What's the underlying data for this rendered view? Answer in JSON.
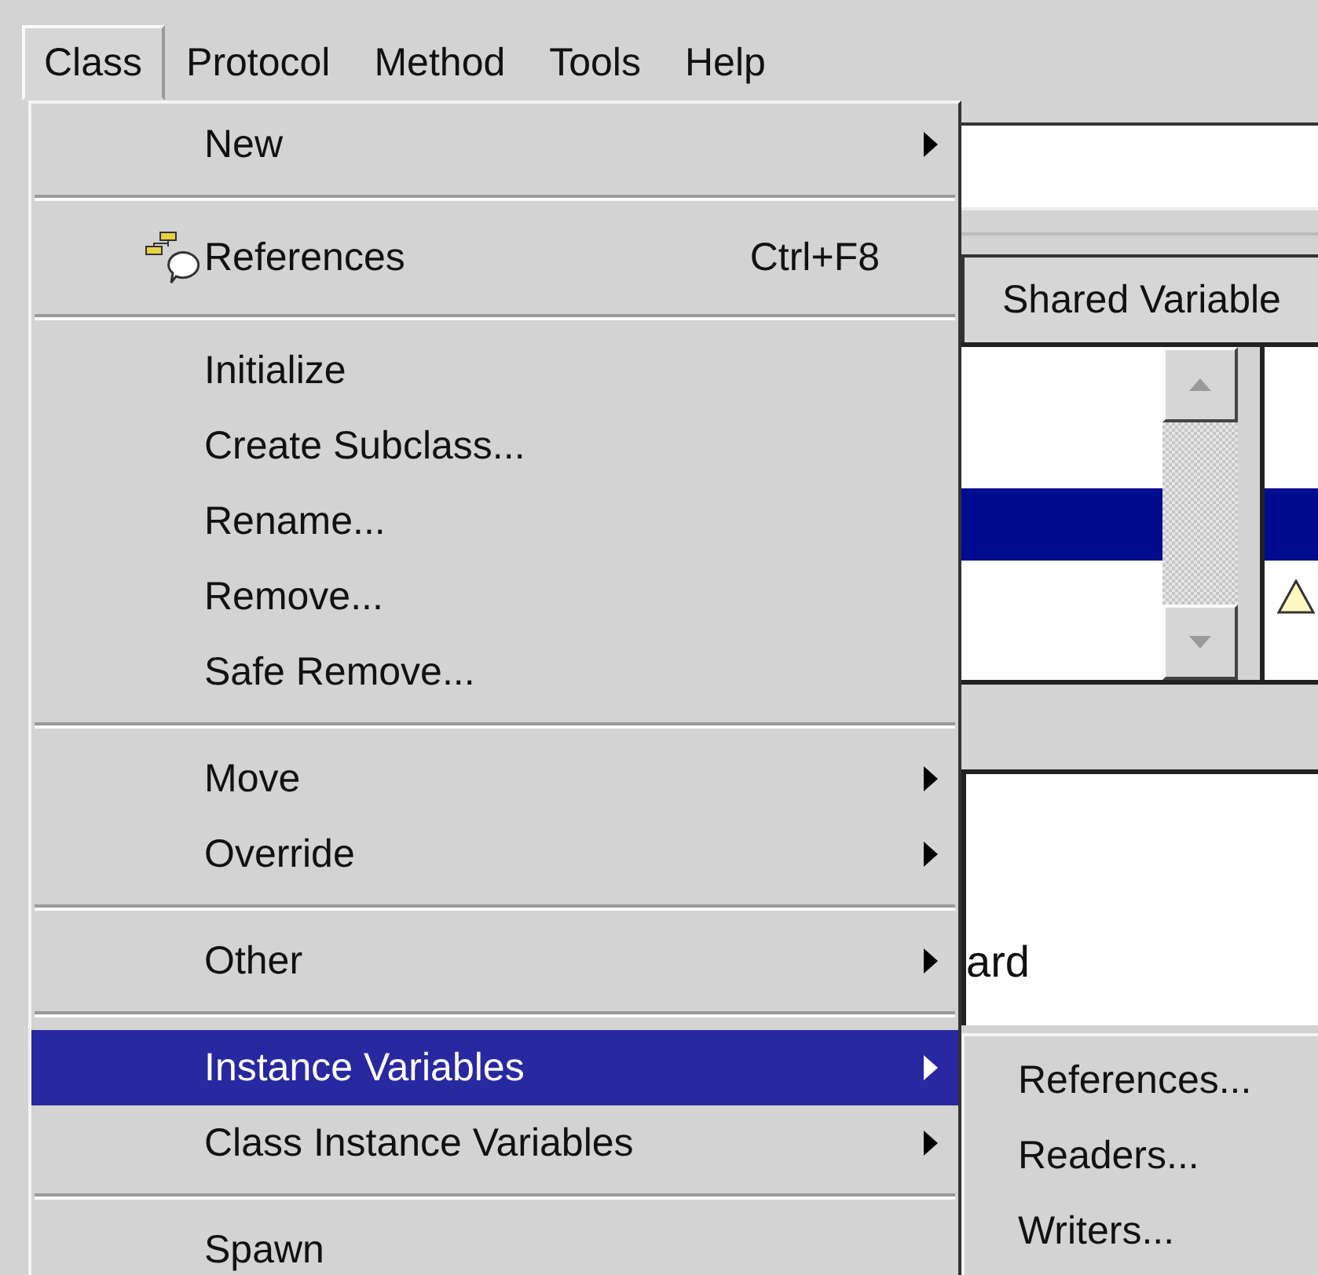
{
  "menubar": [
    {
      "label": "Class",
      "selected": true
    },
    {
      "label": "Protocol",
      "selected": false
    },
    {
      "label": "Method",
      "selected": false
    },
    {
      "label": "Tools",
      "selected": false
    },
    {
      "label": "Help",
      "selected": false
    }
  ],
  "window": {
    "tab": {
      "label": "Shared Variable"
    },
    "panes": [
      {
        "rows": [
          {
            "selected": false
          },
          {
            "selected": true
          },
          {
            "selected": false
          }
        ]
      },
      {
        "rows": [
          {
            "selected": false
          },
          {
            "selected": true
          },
          {
            "selected": false,
            "warning": true
          }
        ]
      }
    ],
    "comment_fragment": "ard"
  },
  "menu": {
    "items": [
      {
        "kind": "item",
        "label": "New",
        "icon": false,
        "submenu": true,
        "selected": false
      },
      {
        "kind": "separator"
      },
      {
        "kind": "item",
        "label": "References",
        "shortcut": "Ctrl+F8",
        "icon": true,
        "submenu": false,
        "selected": false
      },
      {
        "kind": "separator"
      },
      {
        "kind": "item",
        "label": "Initialize",
        "icon": false,
        "submenu": false,
        "selected": false
      },
      {
        "kind": "item",
        "label": "Create Subclass...",
        "icon": false,
        "submenu": false,
        "selected": false
      },
      {
        "kind": "item",
        "label": "Rename...",
        "icon": false,
        "submenu": false,
        "selected": false
      },
      {
        "kind": "item",
        "label": "Remove...",
        "icon": false,
        "submenu": false,
        "selected": false
      },
      {
        "kind": "item",
        "label": "Safe Remove...",
        "icon": false,
        "submenu": false,
        "selected": false
      },
      {
        "kind": "separator"
      },
      {
        "kind": "item",
        "label": "Move",
        "icon": false,
        "submenu": true,
        "selected": false
      },
      {
        "kind": "item",
        "label": "Override",
        "icon": false,
        "submenu": true,
        "selected": false
      },
      {
        "kind": "separator"
      },
      {
        "kind": "item",
        "label": "Other",
        "icon": false,
        "submenu": true,
        "selected": false
      },
      {
        "kind": "separator"
      },
      {
        "kind": "item",
        "label": "Instance Variables",
        "icon": false,
        "submenu": true,
        "selected": true
      },
      {
        "kind": "item",
        "label": "Class Instance Variables",
        "icon": false,
        "submenu": true,
        "selected": false
      },
      {
        "kind": "separator"
      },
      {
        "kind": "item",
        "label": "Spawn",
        "icon": false,
        "submenu": false,
        "selected": false
      }
    ]
  },
  "submenu": {
    "items": [
      {
        "label": "References..."
      },
      {
        "label": "Readers..."
      },
      {
        "label": "Writers..."
      }
    ]
  }
}
